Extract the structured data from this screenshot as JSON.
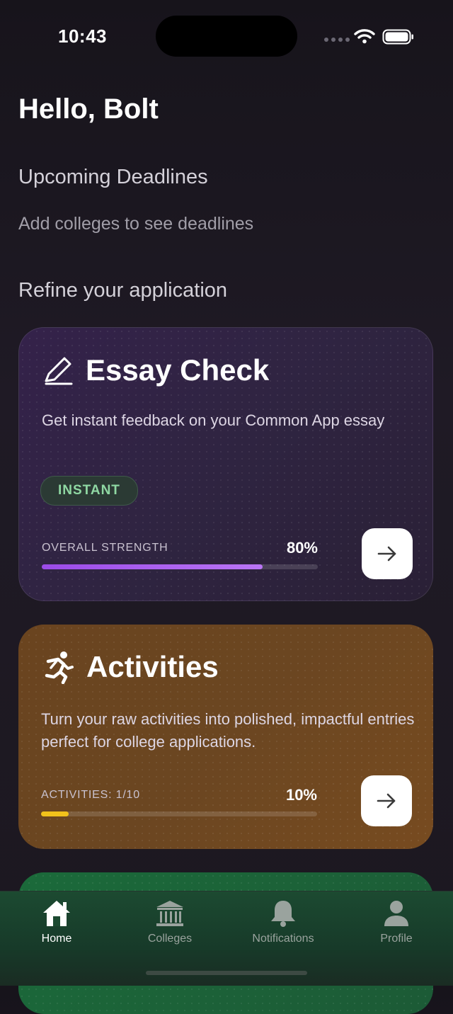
{
  "status": {
    "time": "10:43"
  },
  "greeting": "Hello, Bolt",
  "deadlines": {
    "title": "Upcoming Deadlines",
    "empty_text": "Add colleges to see deadlines"
  },
  "refine": {
    "title": "Refine your application"
  },
  "essay_card": {
    "icon": "pencil-icon",
    "title": "Essay Check",
    "description": "Get instant feedback on your Common App essay",
    "badge": "INSTANT",
    "meter_label": "OVERALL STRENGTH",
    "meter_value": "80%",
    "progress": 0.8,
    "accent": "#a457f0"
  },
  "activities_card": {
    "icon": "running-icon",
    "title": "Activities",
    "description": "Turn your raw activities into polished, impactful entries perfect for college applications.",
    "meter_label": "ACTIVITIES: 1/10",
    "meter_value": "10%",
    "progress": 0.1,
    "accent": "#f2c21b"
  },
  "tabs": [
    {
      "label": "Home",
      "icon": "home-icon",
      "active": true
    },
    {
      "label": "Colleges",
      "icon": "college-icon",
      "active": false
    },
    {
      "label": "Notifications",
      "icon": "bell-icon",
      "active": false
    },
    {
      "label": "Profile",
      "icon": "profile-icon",
      "active": false
    }
  ],
  "colors": {
    "active_tab": "#ffffff",
    "inactive_tab": "#9aa39e",
    "essay_card": "#33234a",
    "activities_card": "#6b4621",
    "green_card": "#1b6a3a"
  }
}
